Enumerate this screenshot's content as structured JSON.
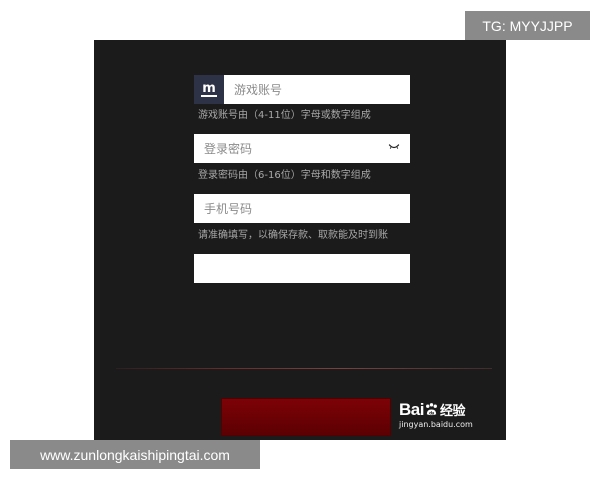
{
  "form": {
    "account": {
      "prefix_label": "m",
      "placeholder": "游戏账号",
      "value": "",
      "hint": "游戏账号由（4-11位）字母或数字组成"
    },
    "password": {
      "placeholder": "登录密码",
      "value": "",
      "hint": "登录密码由（6-16位）字母和数字组成",
      "toggle_icon": "eye-closed-icon"
    },
    "phone": {
      "placeholder": "手机号码",
      "value": "",
      "hint": "请准确填写，以确保存款、取款能及时到账"
    },
    "extra_field": {
      "placeholder": "",
      "value": ""
    },
    "submit": {
      "label": ""
    }
  },
  "watermark": {
    "brand": "Bai",
    "brand_icon": "baidu-paw-icon",
    "brand_suffix": "经验",
    "domain": "jingyan.baidu.com"
  },
  "overlays": {
    "top_right": "TG: MYYJJPP",
    "bottom_left": "www.zunlongkaishipingtai.com"
  },
  "colors": {
    "panel_background": "#1b1b1b",
    "account_prefix": "#2e3247",
    "submit_button": "#6b0205",
    "hint_text": "#a8a8a8",
    "overlay_background": "#8a8a8a"
  }
}
